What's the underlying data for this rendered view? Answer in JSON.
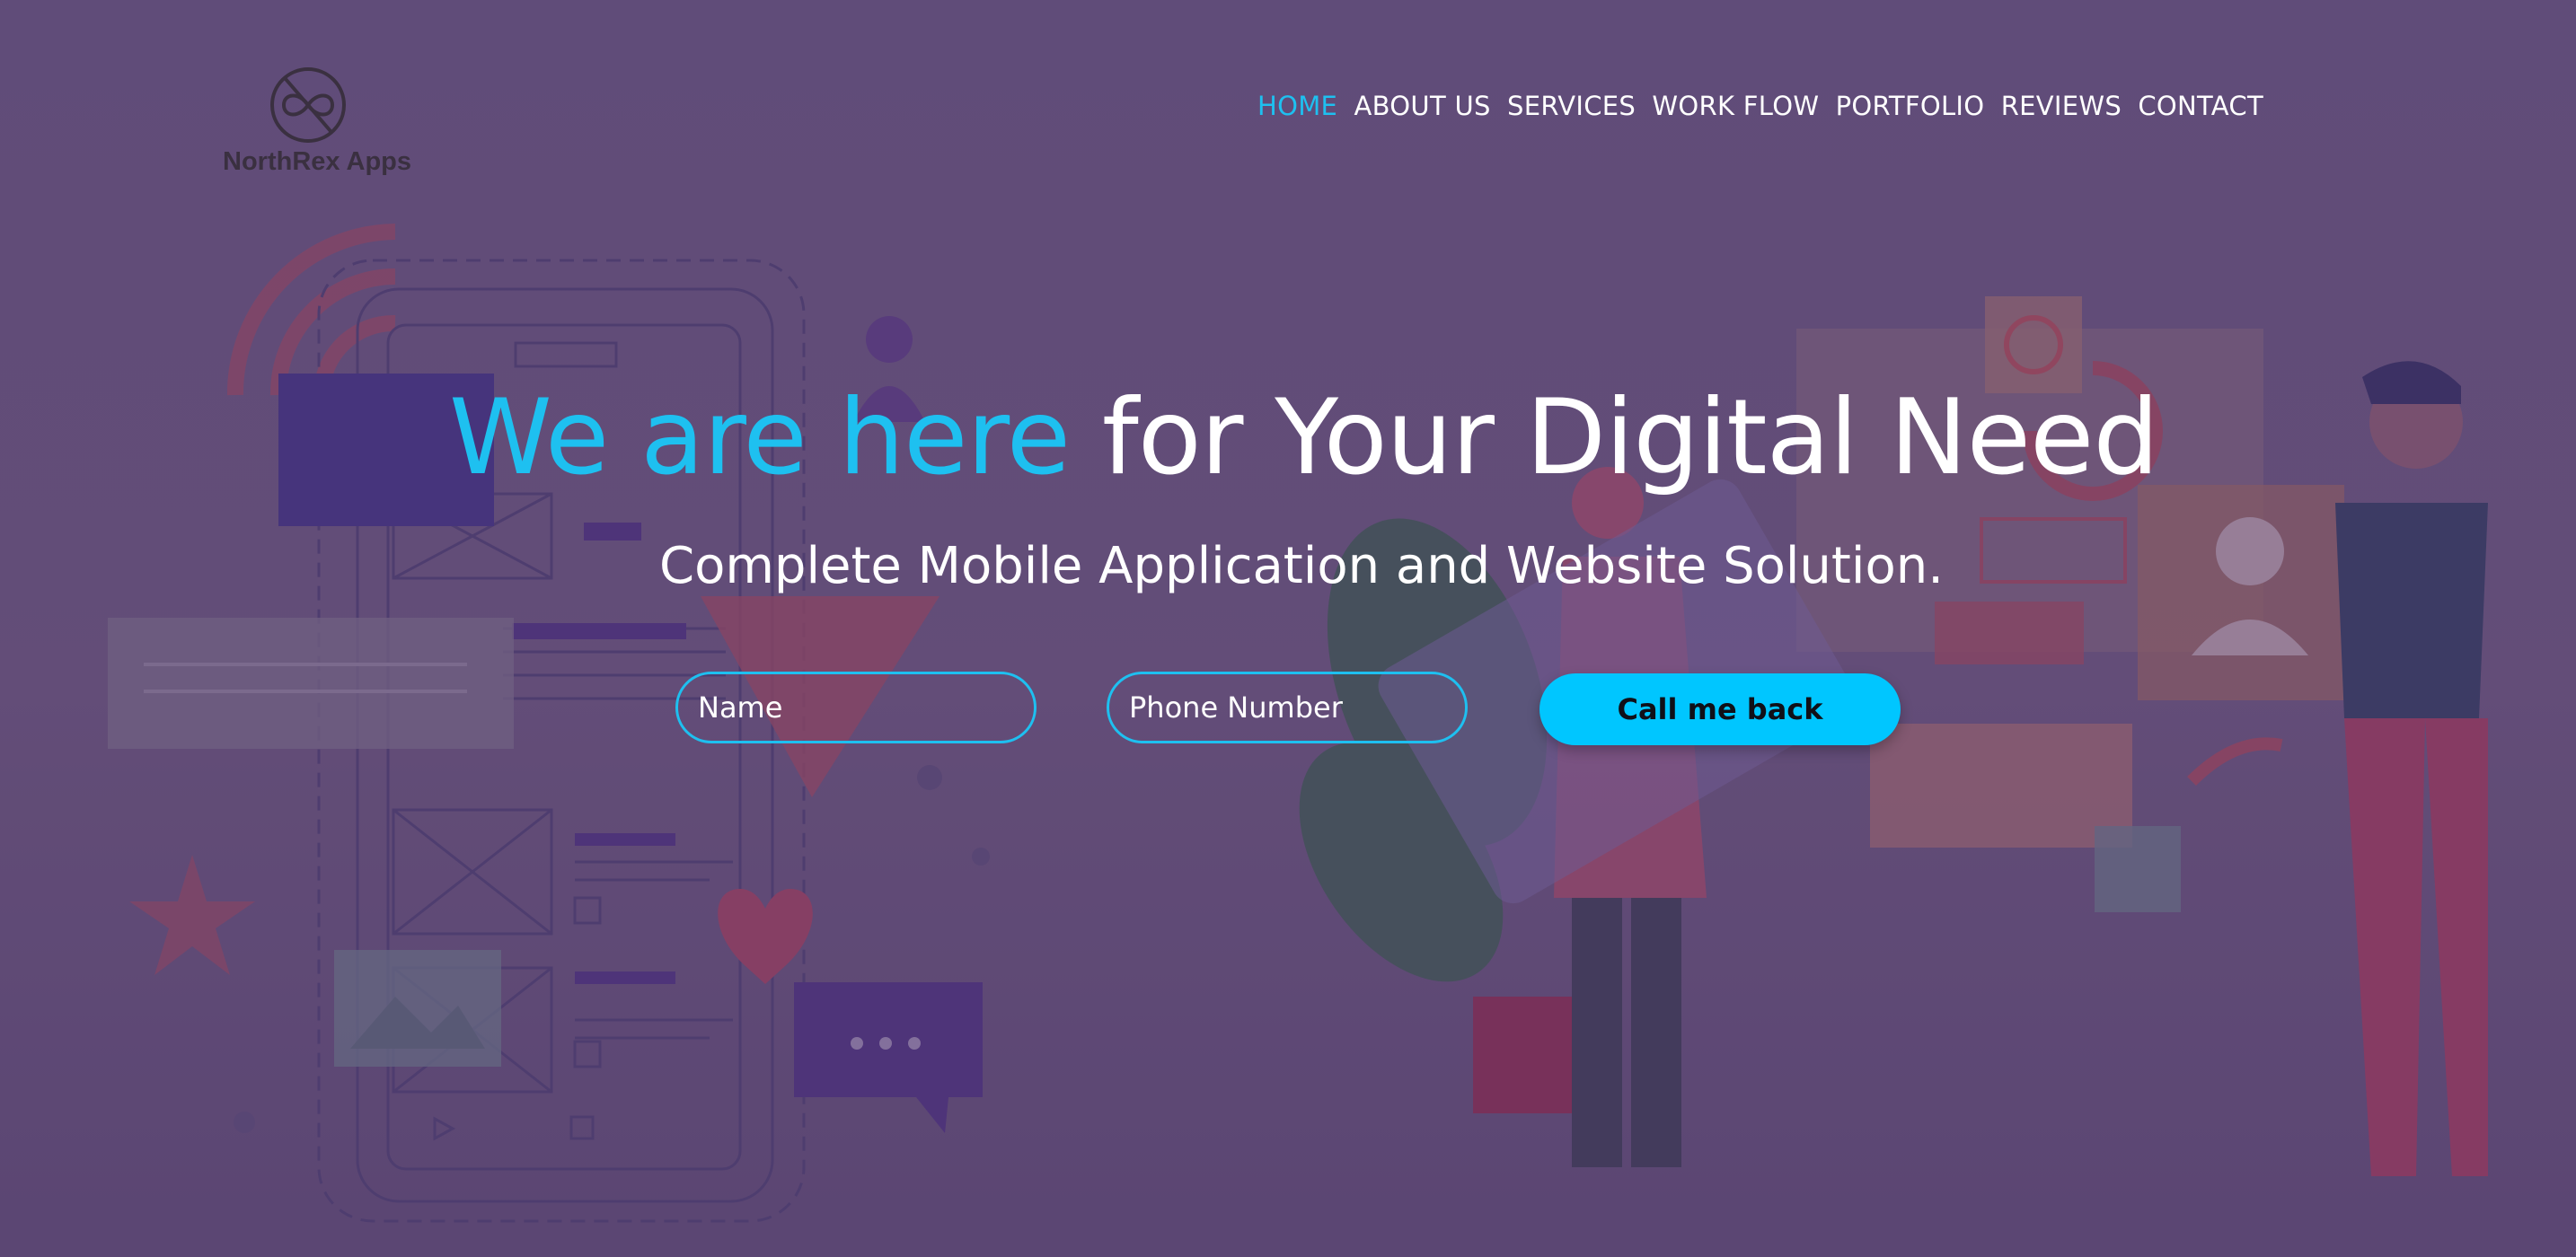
{
  "brand": {
    "name": "NorthRex Apps",
    "logo_icon": "infinity-circle-icon"
  },
  "nav": {
    "items": [
      {
        "label": "HOME",
        "active": true
      },
      {
        "label": "ABOUT US",
        "active": false
      },
      {
        "label": "SERVICES",
        "active": false
      },
      {
        "label": "WORK FLOW",
        "active": false
      },
      {
        "label": "PORTFOLIO",
        "active": false
      },
      {
        "label": "REVIEWS",
        "active": false
      },
      {
        "label": "CONTACT",
        "active": false
      }
    ]
  },
  "hero": {
    "headline_accent": "We are here",
    "headline_rest": " for Your Digital Need",
    "subheadline": "Complete Mobile Application and Website Solution."
  },
  "form": {
    "name_placeholder": "Name",
    "phone_placeholder": "Phone Number",
    "submit_label": "Call me back"
  },
  "colors": {
    "accent": "#1ec0f0",
    "button": "#00c6ff",
    "overlay": "#5e4a70",
    "text": "#ffffff"
  }
}
